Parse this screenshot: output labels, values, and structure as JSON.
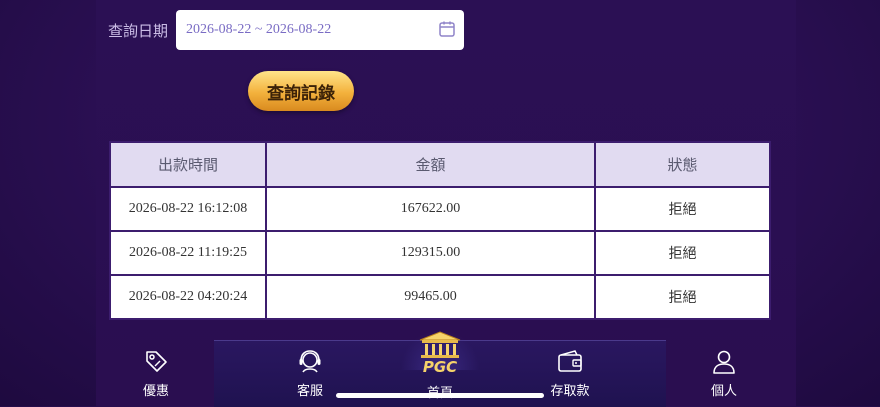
{
  "query": {
    "date_label": "查詢日期",
    "date_range": "2026-08-22 ~ 2026-08-22",
    "button_label": "查詢記錄"
  },
  "table": {
    "headers": [
      "出款時間",
      "金額",
      "狀態"
    ],
    "rows": [
      {
        "time": "2026-08-22 16:12:08",
        "amount": "167622.00",
        "status": "拒絕"
      },
      {
        "time": "2026-08-22 11:19:25",
        "amount": "129315.00",
        "status": "拒絕"
      },
      {
        "time": "2026-08-22 04:20:24",
        "amount": "99465.00",
        "status": "拒絕"
      }
    ]
  },
  "nav": {
    "promo": "優惠",
    "service": "客服",
    "home": "首頁",
    "wallet": "存取款",
    "profile": "個人",
    "logo_text": "PGC"
  },
  "colors": {
    "accent": "#f3b13c",
    "background": "#2a0f52",
    "header_row": "#e1dbf1"
  }
}
